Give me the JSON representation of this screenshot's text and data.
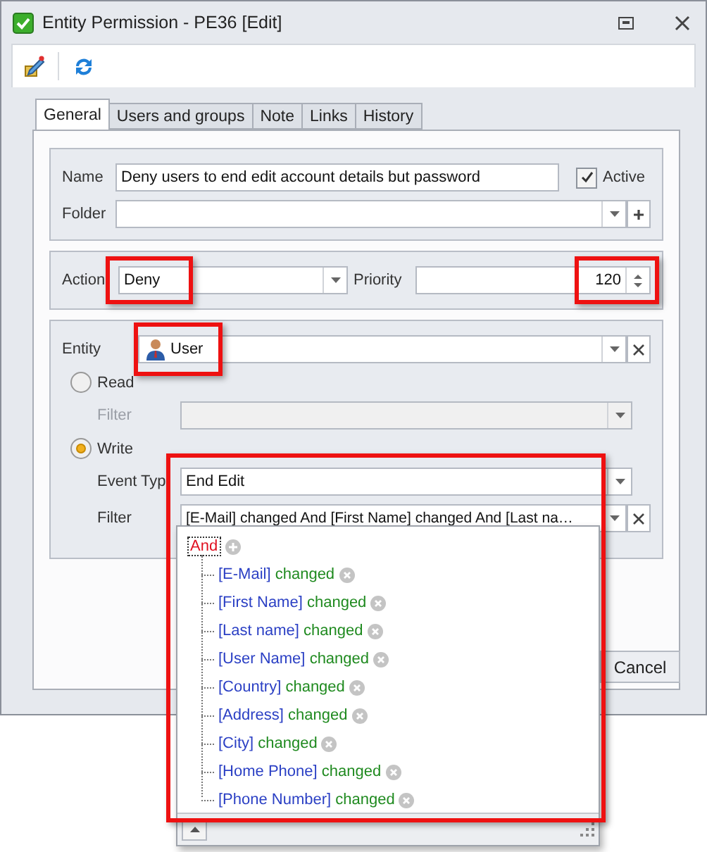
{
  "window": {
    "title": "Entity Permission - PE36 [Edit]"
  },
  "tabs": [
    {
      "label": "General",
      "selected": true
    },
    {
      "label": "Users and groups",
      "selected": false
    },
    {
      "label": "Note",
      "selected": false
    },
    {
      "label": "Links",
      "selected": false
    },
    {
      "label": "History",
      "selected": false
    }
  ],
  "general": {
    "name": {
      "label": "Name",
      "value": "Deny users to end edit account details but password"
    },
    "active": {
      "label": "Active",
      "checked": true
    },
    "folder": {
      "label": "Folder"
    },
    "action": {
      "label": "Action",
      "value": "Deny",
      "highlighted": true
    },
    "priority": {
      "label": "Priority",
      "value": "120",
      "highlighted": true
    },
    "entity": {
      "label": "Entity",
      "value": "User",
      "highlighted": true
    },
    "read": {
      "label": "Read",
      "selected": false
    },
    "read_filter": {
      "label": "Filter",
      "disabled": true
    },
    "write": {
      "label": "Write",
      "selected": true
    },
    "event_type": {
      "label": "Event Typ",
      "value": "End Edit"
    },
    "write_filter": {
      "label": "Filter",
      "value": "[E-Mail] changed  And [First Name] changed  And [Last na…"
    }
  },
  "filter_popup": {
    "highlighted": true,
    "root": {
      "label": "And",
      "children": [
        {
          "field": "[E-Mail]",
          "op": "changed"
        },
        {
          "field": "[First Name]",
          "op": "changed"
        },
        {
          "field": "[Last name]",
          "op": "changed"
        },
        {
          "field": "[User Name]",
          "op": "changed"
        },
        {
          "field": "[Country]",
          "op": "changed"
        },
        {
          "field": "[Address]",
          "op": "changed"
        },
        {
          "field": "[City]",
          "op": "changed"
        },
        {
          "field": "[Home Phone]",
          "op": "changed"
        },
        {
          "field": "[Phone Number]",
          "op": "changed"
        }
      ]
    }
  },
  "buttons": [
    "Cancel"
  ]
}
